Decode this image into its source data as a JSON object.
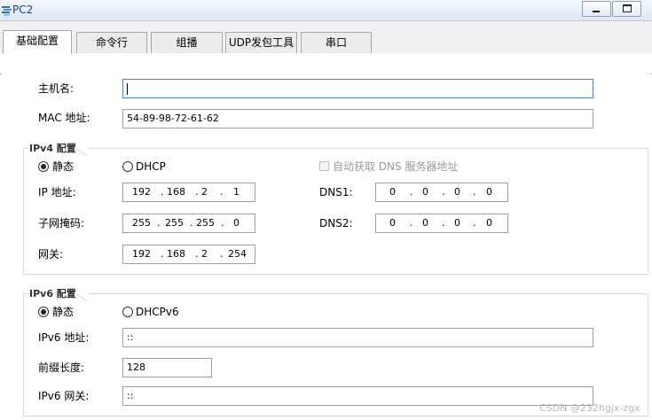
{
  "window": {
    "title": "PC2",
    "icon": "network-pc-icon",
    "minimize_glyph": "minimize-icon",
    "maximize_glyph": "maximize-icon"
  },
  "tabs": [
    {
      "label": "基础配置",
      "active": true
    },
    {
      "label": "命令行",
      "active": false
    },
    {
      "label": "组播",
      "active": false
    },
    {
      "label": "UDP发包工具",
      "active": false
    },
    {
      "label": "串口",
      "active": false
    }
  ],
  "basic": {
    "hostname_label": "主机名:",
    "hostname_value": "",
    "mac_label": "MAC 地址:",
    "mac_value": "54-89-98-72-61-62"
  },
  "ipv4": {
    "title": "IPv4 配置",
    "static_label": "静态",
    "static_selected": true,
    "dhcp_label": "DHCP",
    "auto_dns_label": "自动获取 DNS 服务器地址",
    "ip_label": "IP 地址:",
    "ip": [
      "192",
      "168",
      "2",
      "1"
    ],
    "mask_label": "子网掩码:",
    "mask": [
      "255",
      "255",
      "255",
      "0"
    ],
    "gateway_label": "网关:",
    "gateway": [
      "192",
      "168",
      "2",
      "254"
    ],
    "dns1_label": "DNS1:",
    "dns1": [
      "0",
      "0",
      "0",
      "0"
    ],
    "dns2_label": "DNS2:",
    "dns2": [
      "0",
      "0",
      "0",
      "0"
    ]
  },
  "ipv6": {
    "title": "IPv6 配置",
    "static_label": "静态",
    "static_selected": true,
    "dhcp_label": "DHCPv6",
    "ip_label": "IPv6 地址:",
    "ip_value": "::",
    "prefix_label": "前缀长度:",
    "prefix_value": "128",
    "gateway_label": "IPv6 网关:",
    "gateway_value": "::"
  },
  "watermark": "CSDN @232hgjx-zgx",
  "colors": {
    "title_text": "#1b3f8b",
    "focus_border": "#4f83c6"
  }
}
